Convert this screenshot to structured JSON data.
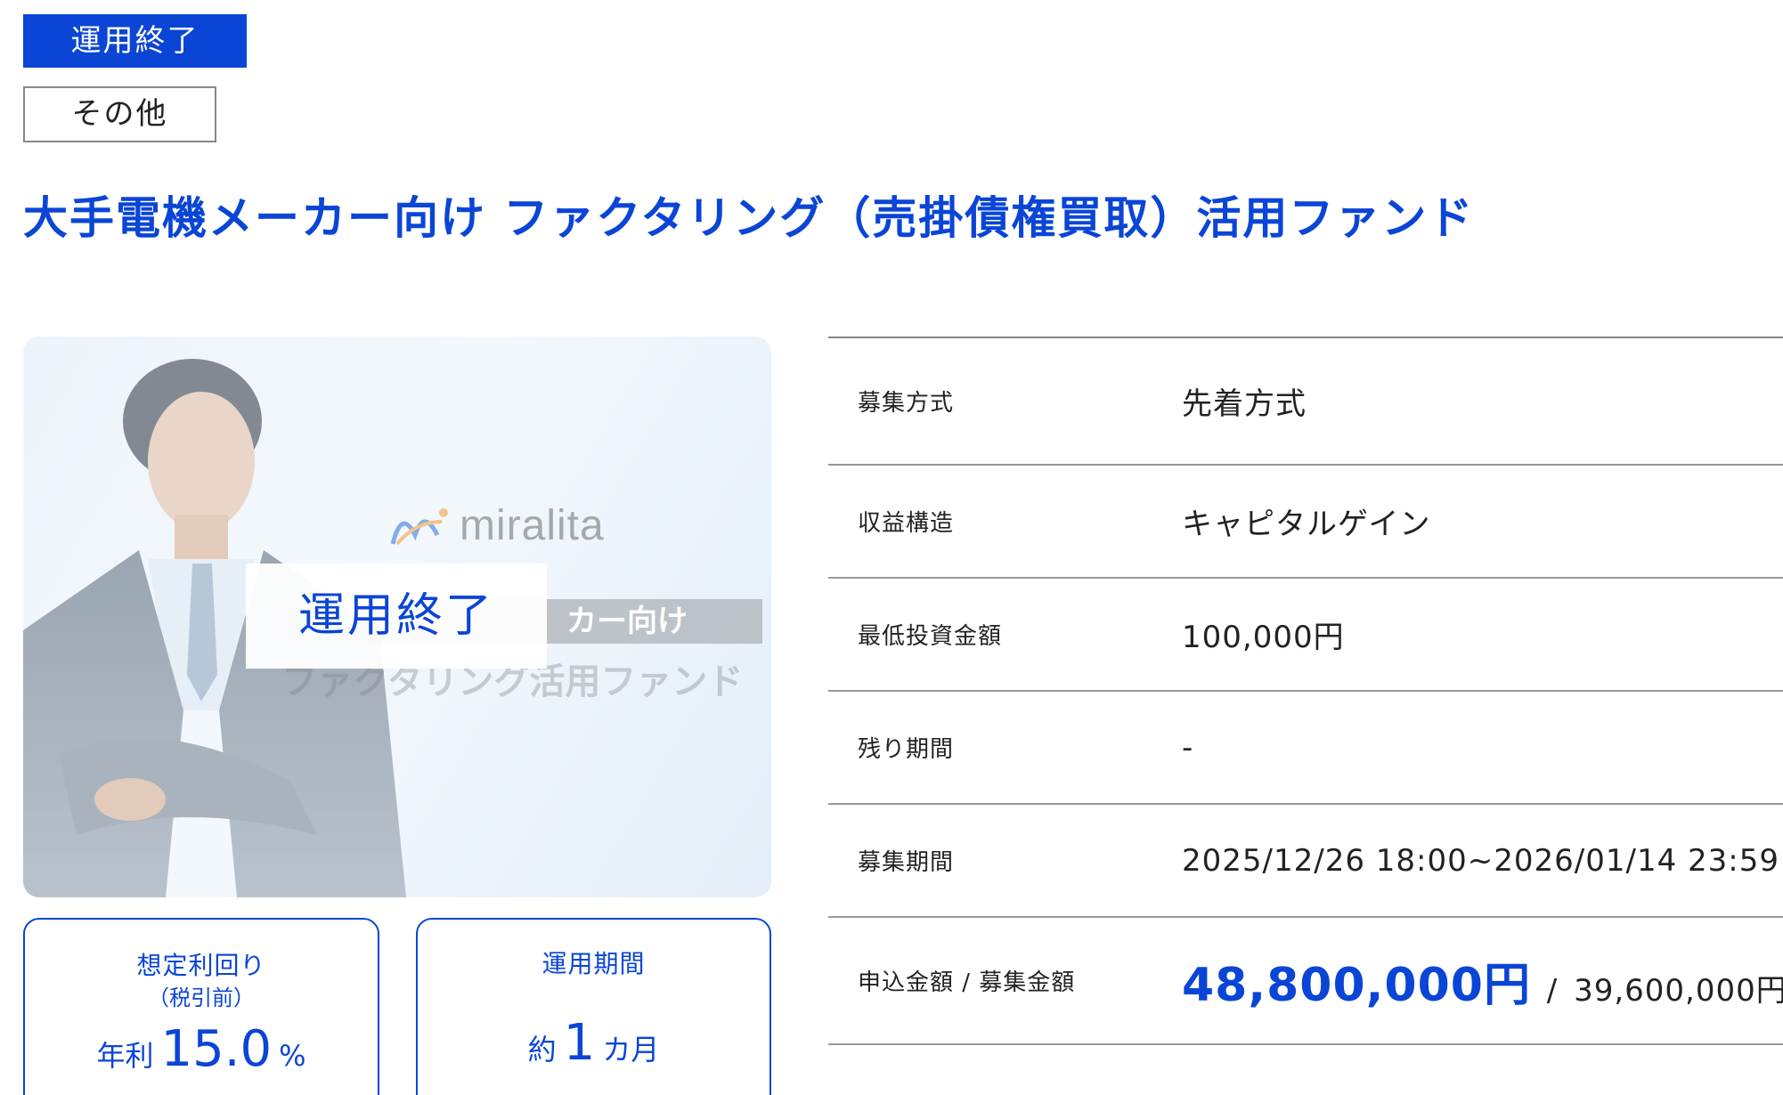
{
  "header": {
    "status_badge": "運用終了",
    "category_tag": "その他",
    "title": "大手電機メーカー向け ファクタリング（売掛債権買取）活用ファンド"
  },
  "hero": {
    "logo_text": "miralita",
    "banner_line1": "カー向け",
    "banner_line2": "ファクタリング活用ファンド",
    "overlay_text": "運用終了"
  },
  "stats": {
    "yield": {
      "label": "想定利回り",
      "sublabel": "（税引前）",
      "prefix": "年利",
      "value": "15.0",
      "unit": "%"
    },
    "period": {
      "label": "運用期間",
      "prefix": "約",
      "value": "1",
      "unit": "カ月"
    }
  },
  "info": {
    "rows": [
      {
        "label": "募集方式",
        "value": "先着方式"
      },
      {
        "label": "収益構造",
        "value": "キャピタルゲイン"
      },
      {
        "label": "最低投資金額",
        "value": "100,000円"
      },
      {
        "label": "残り期間",
        "value": "-"
      },
      {
        "label": "募集期間",
        "value": "2025/12/26 18:00~2026/01/14 23:59"
      }
    ],
    "amount": {
      "label": "申込金額 / 募集金額",
      "applied": "48,800,000円",
      "separator": "/",
      "target": "39,600,000円"
    }
  },
  "colors": {
    "accent": "#0a45d6",
    "border": "#999999"
  }
}
